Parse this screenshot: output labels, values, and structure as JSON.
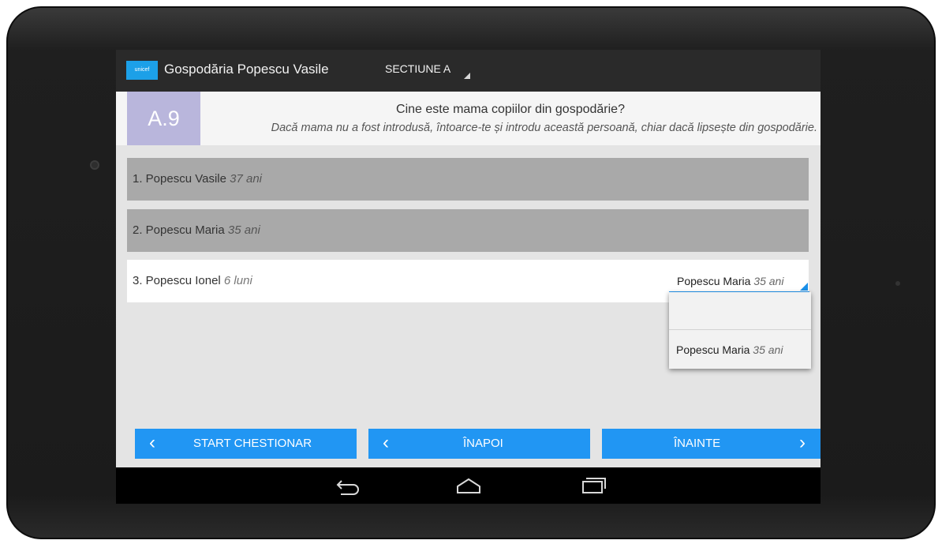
{
  "topbar": {
    "logo_text": "unicef",
    "title": "Gospodăria Popescu Vasile",
    "section": "SECTIUNE A"
  },
  "question": {
    "number": "A.9",
    "title": "Cine este mama copiilor din gospodărie?",
    "hint": "Dacă mama nu a fost introdusă, întoarce-te și introdu această persoană, chiar dacă lipsește din gospodărie."
  },
  "rows": [
    {
      "name": "1. Popescu Vasile",
      "age": "37 ani"
    },
    {
      "name": "2. Popescu Maria",
      "age": "35 ani"
    },
    {
      "name": "3. Popescu Ionel",
      "age": "6 luni",
      "selected_name": "Popescu Maria",
      "selected_age": "35 ani"
    }
  ],
  "dropdown": {
    "options": [
      {
        "name": "",
        "age": ""
      },
      {
        "name": "Popescu Maria",
        "age": "35 ani"
      }
    ]
  },
  "buttons": {
    "start": "START CHESTIONAR",
    "back": "ÎNAPOI",
    "next": "ÎNAINTE"
  },
  "colors": {
    "accent": "#2196f3",
    "question_badge": "#b9b6dc",
    "unicef_blue": "#1ca0e8"
  },
  "icons": [
    "chevron-left-icon",
    "chevron-right-icon",
    "back-icon",
    "home-icon",
    "recents-icon"
  ]
}
